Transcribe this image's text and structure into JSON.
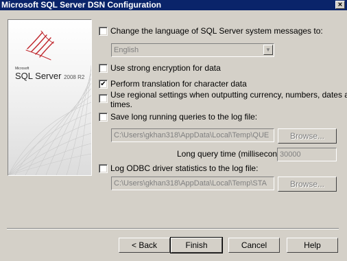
{
  "window": {
    "title": "Microsoft SQL Server DSN Configuration",
    "close": "×"
  },
  "logo": {
    "company": "Microsoft",
    "product": "SQL Server",
    "version": "2008 R2"
  },
  "options": {
    "change_language": {
      "label": "Change the language of SQL Server system messages to:",
      "checked": false
    },
    "language_combo": {
      "value": "English"
    },
    "strong_encryption": {
      "label": "Use strong encryption for data",
      "checked": false
    },
    "perform_translation": {
      "label": "Perform translation for character data",
      "checked": true,
      "mark": "✔"
    },
    "regional_settings": {
      "label_line1": "Use regional settings when outputting currency, numbers, dates and",
      "label_line2": "times.",
      "checked": false
    },
    "long_queries": {
      "label": "Save long running queries to the log file:",
      "checked": false,
      "path": "C:\\Users\\gkhan318\\AppData\\Local\\Temp\\QUE",
      "browse": "Browse..."
    },
    "long_query_time": {
      "label": "Long query time (milliseconds):",
      "value": "30000"
    },
    "odbc_stats": {
      "label": "Log ODBC driver statistics to the log file:",
      "checked": false,
      "path": "C:\\Users\\gkhan318\\AppData\\Local\\Temp\\STA",
      "browse": "Browse..."
    }
  },
  "footer": {
    "back": "< Back",
    "finish": "Finish",
    "cancel": "Cancel",
    "help": "Help"
  }
}
